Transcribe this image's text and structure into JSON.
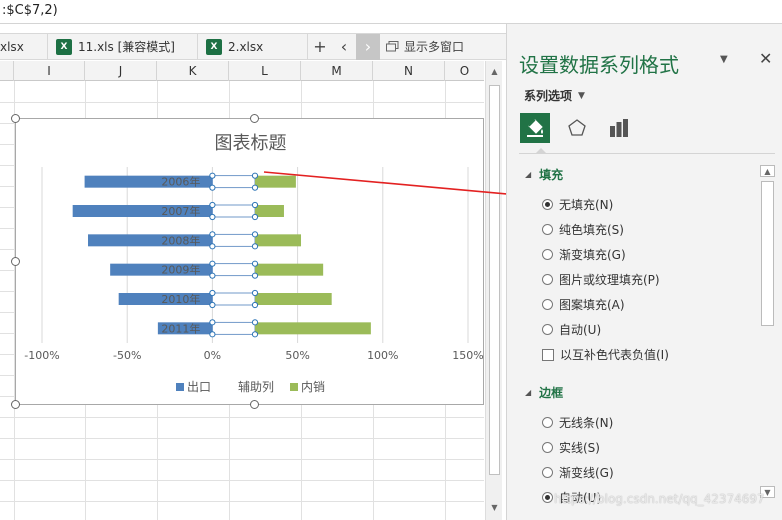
{
  "formula_bar": {
    "text": ":$C$7,2)"
  },
  "tabs": [
    {
      "label": "xlsx",
      "icon": "excel-icon"
    },
    {
      "label": "11.xls  [兼容模式]",
      "icon": "excel-icon"
    },
    {
      "label": "2.xlsx",
      "icon": "excel-icon"
    }
  ],
  "tab_controls": {
    "add": "+",
    "prev": "‹",
    "next": "›",
    "multi_window": "显示多窗口"
  },
  "columns": [
    "I",
    "J",
    "K",
    "L",
    "M",
    "N",
    "O"
  ],
  "chart_data": {
    "type": "bar",
    "orientation": "horizontal",
    "stacked": true,
    "title": "图表标题",
    "categories": [
      "2006年",
      "2007年",
      "2008年",
      "2009年",
      "2010年",
      "2011年"
    ],
    "series": [
      {
        "name": "出口",
        "values": [
          -0.75,
          -0.82,
          -0.73,
          -0.6,
          -0.55,
          -0.32
        ],
        "color": "#4f81bd"
      },
      {
        "name": "辅助列",
        "values": [
          0.25,
          0.25,
          0.25,
          0.25,
          0.25,
          0.25
        ],
        "color": "#ffffff"
      },
      {
        "name": "内销",
        "values": [
          0.24,
          0.17,
          0.27,
          0.4,
          0.45,
          0.68
        ],
        "color": "#9bbb59"
      }
    ],
    "x_ticks": [
      "-100%",
      "-50%",
      "0%",
      "50%",
      "100%",
      "150%"
    ],
    "xlim": [
      -1.0,
      1.5
    ],
    "legend_position": "bottom",
    "grid": "vertical"
  },
  "pane": {
    "title": "设置数据系列格式",
    "series_options": "系列选项",
    "icons": [
      "paint-bucket-icon",
      "pentagon-icon",
      "bar-chart-icon"
    ],
    "fill_section": {
      "title": "填充",
      "options": [
        {
          "label": "无填充(N)",
          "checked": true
        },
        {
          "label": "纯色填充(S)",
          "checked": false
        },
        {
          "label": "渐变填充(G)",
          "checked": false
        },
        {
          "label": "图片或纹理填充(P)",
          "checked": false
        },
        {
          "label": "图案填充(A)",
          "checked": false
        },
        {
          "label": "自动(U)",
          "checked": false
        }
      ],
      "checkbox": "以互补色代表负值(I)"
    },
    "border_section": {
      "title": "边框",
      "options": [
        {
          "label": "无线条(N)",
          "checked": false
        },
        {
          "label": "实线(S)",
          "checked": false
        },
        {
          "label": "渐变线(G)",
          "checked": false
        },
        {
          "label": "自动(U)",
          "checked": true
        }
      ]
    }
  },
  "watermark": "https://blog.csdn.net/qq_42374697",
  "colors": {
    "accent": "#217346",
    "arrow": "#e32121"
  }
}
